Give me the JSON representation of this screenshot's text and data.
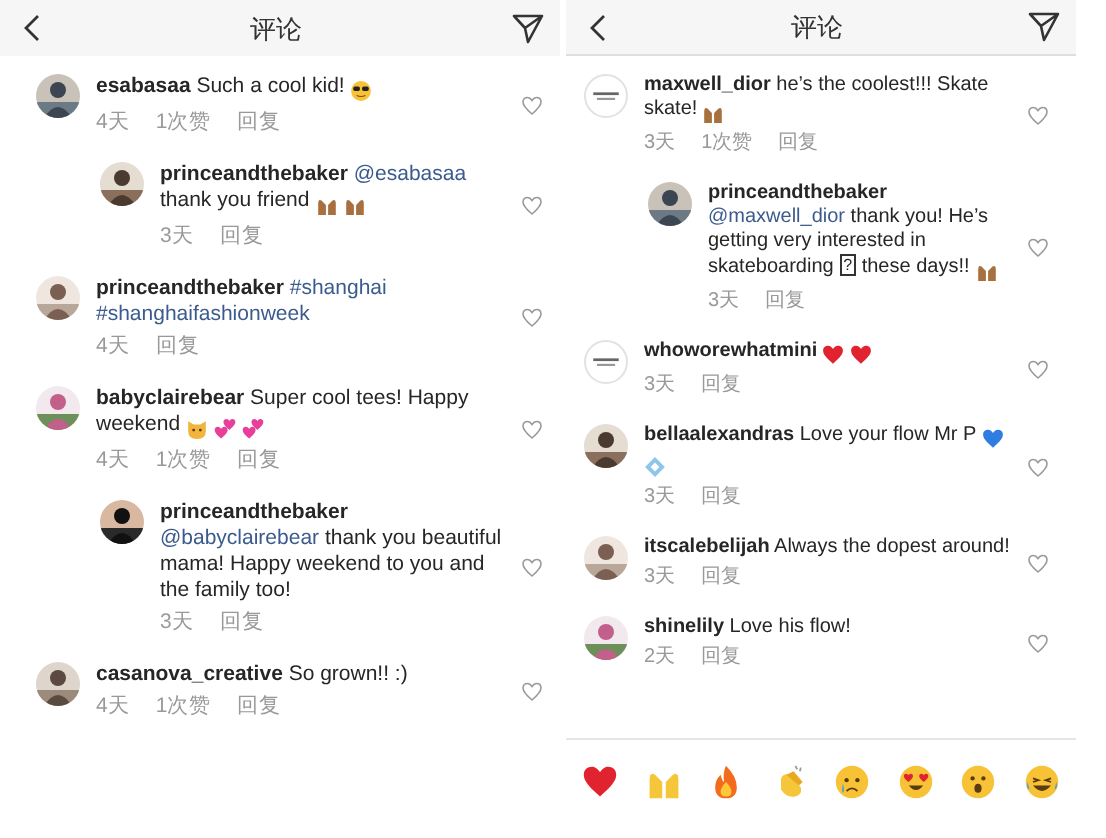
{
  "panels": [
    {
      "title": "评论",
      "comments": [
        {
          "user": "esabasaa",
          "avatar": {
            "kind": "picture"
          },
          "body": [
            {
              "kind": "text",
              "text": "Such a cool kid!"
            },
            {
              "kind": "sunglasses"
            }
          ],
          "time": "4天",
          "likes": "1次赞",
          "reply": "回复",
          "replies": [
            {
              "user": "princeandthebaker",
              "avatar": {
                "kind": "picture"
              },
              "body": [
                {
                  "kind": "link",
                  "text": "@esabasaa"
                },
                {
                  "kind": "text",
                  "text": "thank you friend"
                },
                {
                  "kind": "raised-hands-brown"
                },
                {
                  "kind": "raised-hands-brown"
                }
              ],
              "time": "3天",
              "reply": "回复"
            }
          ]
        },
        {
          "user": "princeandthebaker",
          "avatar": {
            "kind": "picture"
          },
          "body": [
            {
              "kind": "link",
              "text": "#shanghai"
            },
            {
              "kind": "link",
              "text": "#shanghaifashionweek"
            }
          ],
          "time": "4天",
          "reply": "回复"
        },
        {
          "user": "babyclairebear",
          "avatar": {
            "kind": "picture"
          },
          "body": [
            {
              "kind": "text",
              "text": "Super cool tees! Happy weekend"
            },
            {
              "kind": "cat"
            },
            {
              "kind": "two-hearts"
            },
            {
              "kind": "two-hearts"
            }
          ],
          "time": "4天",
          "likes": "1次赞",
          "reply": "回复",
          "replies": [
            {
              "user": "princeandthebaker",
              "avatar": {
                "kind": "picture"
              },
              "body": [
                {
                  "kind": "link",
                  "text": "@babyclairebear"
                },
                {
                  "kind": "text",
                  "text": "thank you beautiful mama! Happy weekend to you and the family too!"
                }
              ],
              "time": "3天",
              "reply": "回复"
            }
          ]
        },
        {
          "user": "casanova_creative",
          "avatar": {
            "kind": "picture"
          },
          "body": [
            {
              "kind": "text",
              "text": "So grown!! :)"
            }
          ],
          "time": "4天",
          "likes": "1次赞",
          "reply": "回复"
        }
      ]
    },
    {
      "title": "评论",
      "comments": [
        {
          "user": "maxwell_dior",
          "avatar": {
            "kind": "logo"
          },
          "body": [
            {
              "kind": "text",
              "text": "he’s the coolest!!! Skate skate!"
            },
            {
              "kind": "raised-hands-brown"
            }
          ],
          "time": "3天",
          "likes": "1次赞",
          "reply": "回复",
          "replies": [
            {
              "user": "princeandthebaker",
              "avatar": {
                "kind": "picture"
              },
              "body": [
                {
                  "kind": "link",
                  "text": "@maxwell_dior"
                },
                {
                  "kind": "text",
                  "text": "thank you! He’s getting very interested in skateboarding"
                },
                {
                  "kind": "boxed",
                  "text": "?"
                },
                {
                  "kind": "text",
                  "text": "these days!!"
                },
                {
                  "kind": "raised-hands-brown"
                }
              ],
              "time": "3天",
              "reply": "回复"
            }
          ]
        },
        {
          "user": "whoworewhatmini",
          "avatar": {
            "kind": "logo"
          },
          "body": [
            {
              "kind": "red-heart"
            },
            {
              "kind": "red-heart"
            }
          ],
          "time": "3天",
          "reply": "回复"
        },
        {
          "user": "bellaalexandras",
          "avatar": {
            "kind": "picture"
          },
          "body": [
            {
              "kind": "text",
              "text": "Love your flow Mr P"
            },
            {
              "kind": "blue-heart"
            },
            {
              "kind": "diamond"
            }
          ],
          "time": "3天",
          "reply": "回复"
        },
        {
          "user": "itscalebelijah",
          "avatar": {
            "kind": "picture"
          },
          "body": [
            {
              "kind": "text",
              "text": "Always the dopest around!"
            }
          ],
          "time": "3天",
          "reply": "回复"
        },
        {
          "user": "shinelily",
          "avatar": {
            "kind": "picture"
          },
          "body": [
            {
              "kind": "text",
              "text": "Love his flow!"
            }
          ],
          "time": "2天",
          "reply": "回复"
        }
      ],
      "reactions": [
        {
          "kind": "red-heart"
        },
        {
          "kind": "raised-hands"
        },
        {
          "kind": "fire"
        },
        {
          "kind": "clap"
        },
        {
          "kind": "crying"
        },
        {
          "kind": "heart-eyes"
        },
        {
          "kind": "surprised"
        },
        {
          "kind": "laughing"
        }
      ]
    }
  ]
}
